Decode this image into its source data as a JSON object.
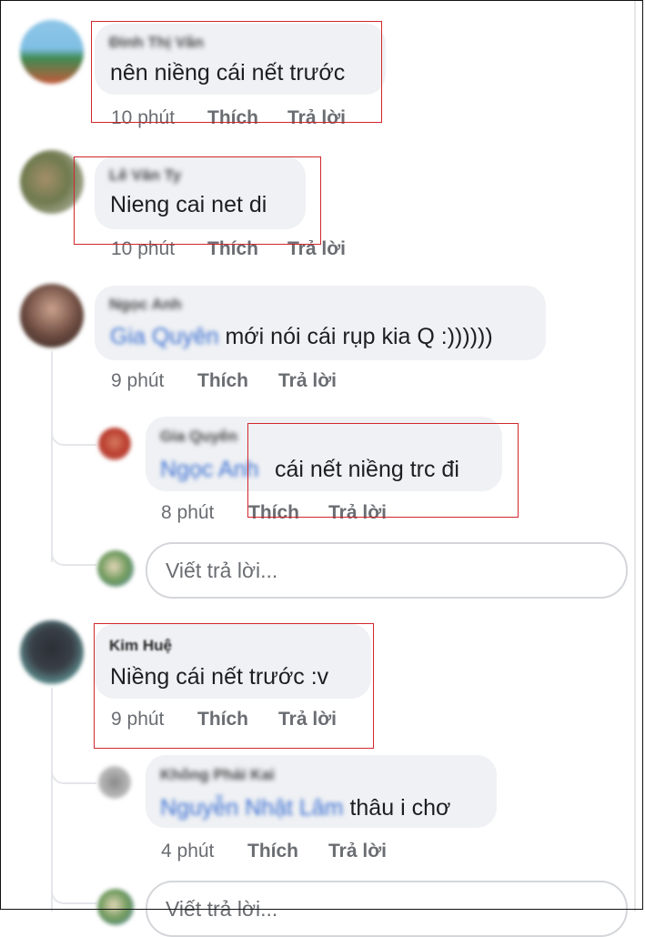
{
  "comments": [
    {
      "author": "Đinh Thị Vân",
      "text": "nên niềng cái nết trước",
      "time": "10 phút",
      "like": "Thích",
      "reply": "Trả lời"
    },
    {
      "author": "Lê Văn Ty",
      "text": "Nieng cai net di",
      "time": "10 phút",
      "like": "Thích",
      "reply": "Trả lời"
    },
    {
      "author": "Ngọc Anh",
      "mention": "Gia Quyên",
      "text": " mới nói cái rụp kia Q :))))))",
      "time": "9 phút",
      "like": "Thích",
      "reply": "Trả lời",
      "reply_item": {
        "author": "Gia Quyên",
        "mention": "Ngọc Anh",
        "text": "cái nết niềng trc đi",
        "time": "8 phút",
        "like": "Thích",
        "reply": "Trả lời"
      },
      "reply_placeholder": "Viết trả lời..."
    },
    {
      "author": "Kim Huệ",
      "text": "Niềng cái nết trước :v",
      "time": "9 phút",
      "like": "Thích",
      "reply": "Trả lời",
      "reply_item": {
        "author": "Không Phải Kai",
        "mention": "Nguyễn Nhật Lâm",
        "text": " thâu i chơ",
        "time": "4 phút",
        "like": "Thích",
        "reply": "Trả lời"
      },
      "reply_placeholder": "Viết trả lời..."
    }
  ],
  "colors": {
    "bubble": "#eff1f4",
    "highlight_box": "#d1272c",
    "mention": "#3b6fd1",
    "meta_text": "#6a6d72"
  }
}
